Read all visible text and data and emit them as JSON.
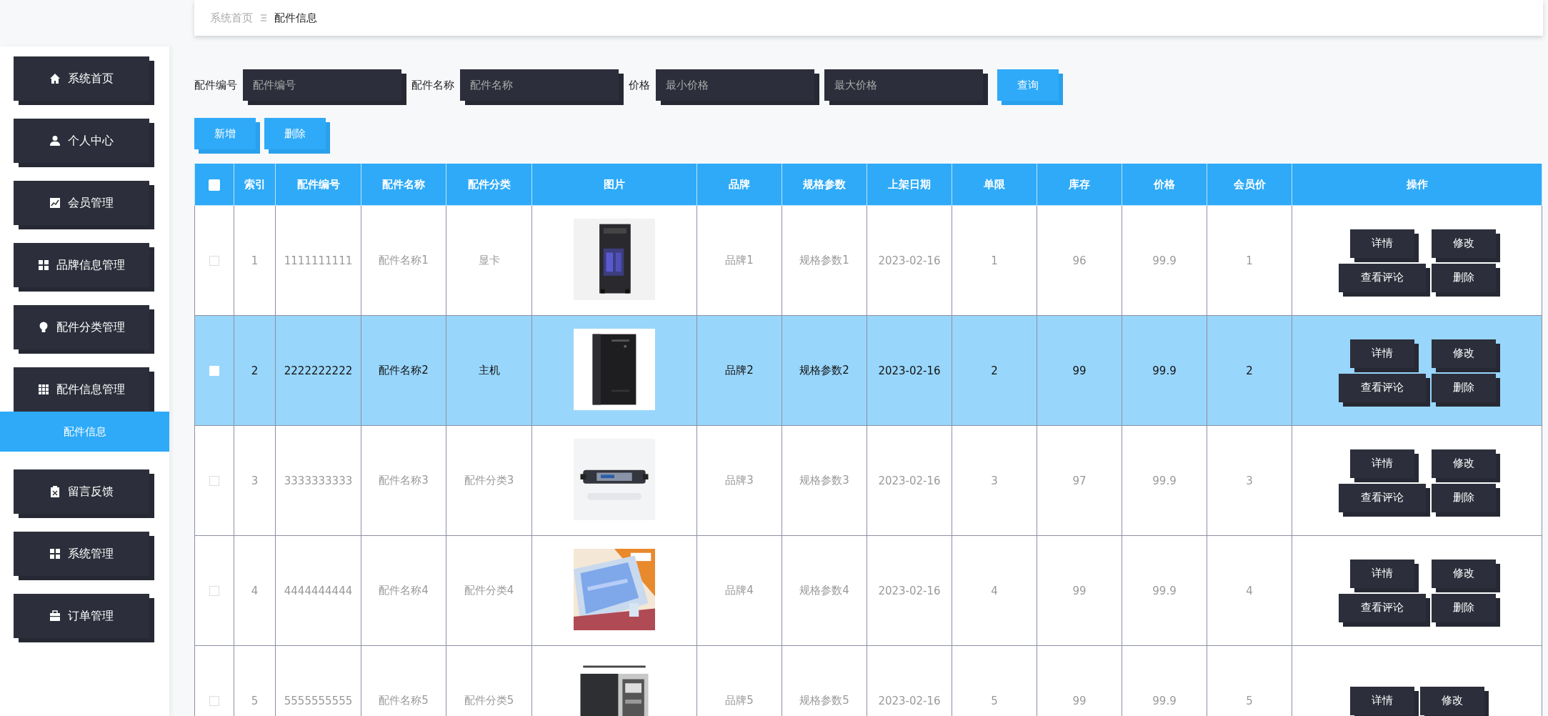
{
  "breadcrumb": [
    {
      "label": "系统首页",
      "selected": false
    },
    {
      "label": "配件信息",
      "selected": true
    }
  ],
  "sidebar": {
    "items": [
      {
        "label": "系统首页",
        "expanded": false
      },
      {
        "label": "个人中心",
        "expanded": false
      },
      {
        "label": "会员管理",
        "expanded": false
      },
      {
        "label": "品牌信息管理",
        "expanded": false
      },
      {
        "label": "配件分类管理",
        "expanded": false
      },
      {
        "label": "配件信息管理",
        "expanded": true,
        "children": [
          {
            "label": "配件信息",
            "selected": true
          }
        ]
      },
      {
        "label": "留言反馈",
        "expanded": false
      },
      {
        "label": "系统管理",
        "expanded": false
      },
      {
        "label": "订单管理",
        "expanded": false
      }
    ]
  },
  "search": {
    "fields": [
      {
        "label": "配件编号",
        "placeholder": "配件编号"
      },
      {
        "label": "配件名称",
        "placeholder": "配件名称"
      },
      {
        "label": "价格",
        "placeholder": "最小价格"
      },
      {
        "placeholder": "最大价格"
      }
    ],
    "button": "查询"
  },
  "toolbar": [
    "新增",
    "删除"
  ],
  "table": {
    "header_checkbox": {
      "checked": false
    },
    "columns": [
      "索引",
      "配件编号",
      "配件名称",
      "配件分类",
      "图片",
      "品牌",
      "规格参数",
      "上架日期",
      "单限",
      "库存",
      "价格",
      "会员价",
      "操作"
    ],
    "rows": [
      {
        "selected": false,
        "index": "1",
        "code": "1111111111",
        "name": "配件名称1",
        "category": "显卡",
        "picture": {
          "kind": "picture"
        },
        "brand": "品牌1",
        "spec": "规格参数1",
        "date": "2023-02-16",
        "limit": "1",
        "stock": "96",
        "price": "99.9",
        "member_price": "1",
        "actions": [
          "详情",
          "修改",
          "查看评论",
          "删除"
        ]
      },
      {
        "selected": true,
        "index": "2",
        "code": "2222222222",
        "name": "配件名称2",
        "category": "主机",
        "picture": {
          "kind": "picture"
        },
        "brand": "品牌2",
        "spec": "规格参数2",
        "date": "2023-02-16",
        "limit": "2",
        "stock": "99",
        "price": "99.9",
        "member_price": "2",
        "actions": [
          "详情",
          "修改",
          "查看评论",
          "删除"
        ]
      },
      {
        "selected": false,
        "index": "3",
        "code": "3333333333",
        "name": "配件名称3",
        "category": "配件分类3",
        "picture": {
          "kind": "picture"
        },
        "brand": "品牌3",
        "spec": "规格参数3",
        "date": "2023-02-16",
        "limit": "3",
        "stock": "97",
        "price": "99.9",
        "member_price": "3",
        "actions": [
          "详情",
          "修改",
          "查看评论",
          "删除"
        ]
      },
      {
        "selected": false,
        "index": "4",
        "code": "4444444444",
        "name": "配件名称4",
        "category": "配件分类4",
        "picture": {
          "kind": "picture"
        },
        "brand": "品牌4",
        "spec": "规格参数4",
        "date": "2023-02-16",
        "limit": "4",
        "stock": "99",
        "price": "99.9",
        "member_price": "4",
        "actions": [
          "详情",
          "修改",
          "查看评论",
          "删除"
        ]
      },
      {
        "selected": false,
        "index": "5",
        "code": "5555555555",
        "name": "配件名称5",
        "category": "配件分类5",
        "picture": {
          "kind": "picture"
        },
        "brand": "品牌5",
        "spec": "规格参数5",
        "date": "2023-02-16",
        "limit": "5",
        "stock": "99",
        "price": "99.9",
        "member_price": "5",
        "actions": [
          "详情",
          "修改"
        ]
      }
    ]
  }
}
